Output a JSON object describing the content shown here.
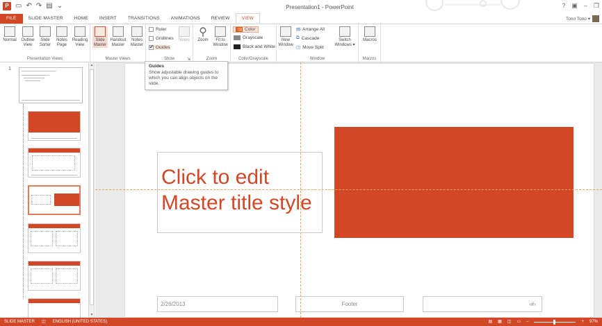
{
  "window": {
    "title": "Presentation1 - PowerPoint",
    "controls": [
      "?",
      "▣",
      "–",
      "❐"
    ]
  },
  "qat": {
    "logo": "P",
    "save_icon": "💾",
    "undo_icon": "↶",
    "redo_icon": "↷",
    "start_icon": "▤",
    "more_icon": "⌄"
  },
  "tabs": [
    {
      "label": "FILE"
    },
    {
      "label": "SLIDE MASTER"
    },
    {
      "label": "HOME"
    },
    {
      "label": "INSERT"
    },
    {
      "label": "TRANSITIONS"
    },
    {
      "label": "ANIMATIONS"
    },
    {
      "label": "REVIEW"
    },
    {
      "label": "VIEW"
    }
  ],
  "user": {
    "name": "Tono Tono ▾"
  },
  "ribbon": {
    "presentation_views": {
      "label": "Presentation Views",
      "buttons": [
        {
          "label": "Normal"
        },
        {
          "label": "Outline View"
        },
        {
          "label": "Slide Sorter"
        },
        {
          "label": "Notes Page"
        },
        {
          "label": "Reading View"
        }
      ]
    },
    "master_views": {
      "label": "Master Views",
      "buttons": [
        {
          "label": "Slide Master"
        },
        {
          "label": "Handout Master"
        },
        {
          "label": "Notes Master"
        }
      ]
    },
    "show": {
      "label": "Show",
      "ruler": "Ruler",
      "gridlines": "Gridlines",
      "guides": "Guides",
      "guides_checked": "✔",
      "notes": "Notes",
      "launcher": "⇲"
    },
    "zoom": {
      "label": "Zoom",
      "zoom": "Zoom",
      "fit": "Fit to Window"
    },
    "color": {
      "label": "Color/Grayscale",
      "color": "Color",
      "grayscale": "Grayscale",
      "bw": "Black and White"
    },
    "window": {
      "label": "Window",
      "new_window": "New Window",
      "arrange_all": "Arrange All",
      "cascade": "Cascade",
      "move_split": "Move Split",
      "switch": "Switch Windows ▾"
    },
    "macros": {
      "label": "Macros",
      "macros": "Macros"
    }
  },
  "tooltip": {
    "title": "Guides",
    "body": "Show adjustable drawing guides to which you can align objects on the slide."
  },
  "thumbnails": {
    "slide_number": "1",
    "scroll_up": "▲",
    "scroll_down": "▼"
  },
  "slide": {
    "title_line1": "Click to edit",
    "title_line2": "Master title style",
    "date": "2/26/2013",
    "footer": "Footer",
    "page_number": "‹#›"
  },
  "status": {
    "mode": "SLIDE MASTER",
    "language": "ENGLISH (UNITED STATES)",
    "zoom": "97%"
  },
  "colors": {
    "accent": "#d24726",
    "guide": "#e8a45a"
  }
}
